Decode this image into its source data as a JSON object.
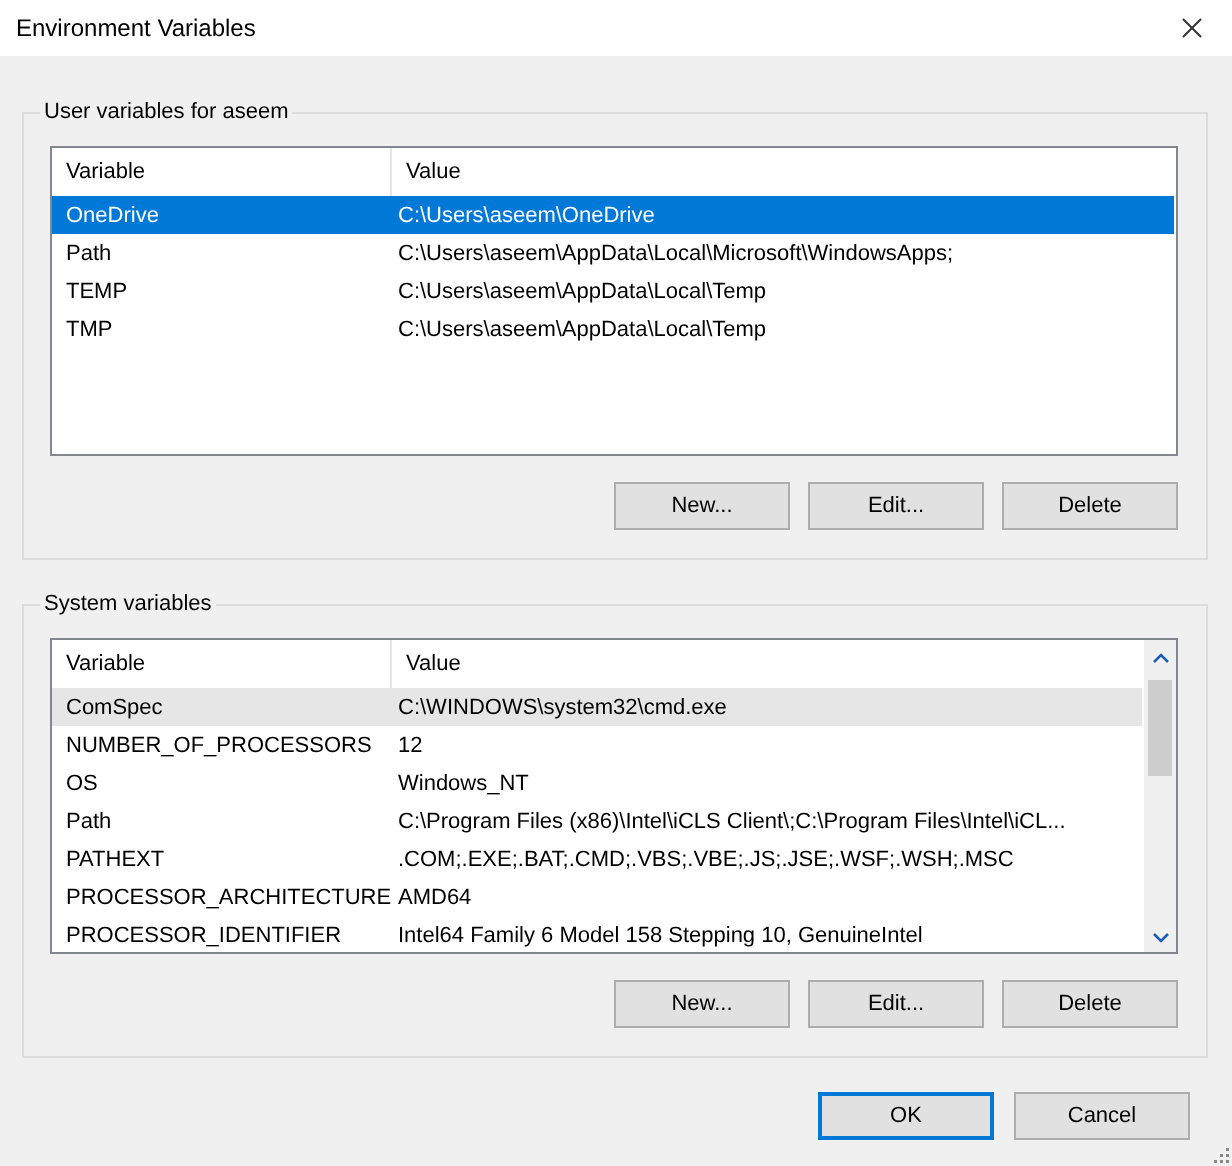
{
  "window": {
    "title": "Environment Variables"
  },
  "user_variables": {
    "label": "User variables for aseem",
    "columns": [
      "Variable",
      "Value"
    ],
    "focused": true,
    "rows": [
      {
        "variable": "OneDrive",
        "value": "C:\\Users\\aseem\\OneDrive",
        "selected": true
      },
      {
        "variable": "Path",
        "value": "C:\\Users\\aseem\\AppData\\Local\\Microsoft\\WindowsApps;",
        "selected": false
      },
      {
        "variable": "TEMP",
        "value": "C:\\Users\\aseem\\AppData\\Local\\Temp",
        "selected": false
      },
      {
        "variable": "TMP",
        "value": "C:\\Users\\aseem\\AppData\\Local\\Temp",
        "selected": false
      }
    ],
    "buttons": [
      "New...",
      "Edit...",
      "Delete"
    ]
  },
  "system_variables": {
    "label": "System variables",
    "columns": [
      "Variable",
      "Value"
    ],
    "focused": false,
    "rows": [
      {
        "variable": "ComSpec",
        "value": "C:\\WINDOWS\\system32\\cmd.exe",
        "selected": true
      },
      {
        "variable": "NUMBER_OF_PROCESSORS",
        "value": "12",
        "selected": false
      },
      {
        "variable": "OS",
        "value": "Windows_NT",
        "selected": false
      },
      {
        "variable": "Path",
        "value": "C:\\Program Files (x86)\\Intel\\iCLS Client\\;C:\\Program Files\\Intel\\iCL...",
        "selected": false
      },
      {
        "variable": "PATHEXT",
        "value": ".COM;.EXE;.BAT;.CMD;.VBS;.VBE;.JS;.JSE;.WSF;.WSH;.MSC",
        "selected": false
      },
      {
        "variable": "PROCESSOR_ARCHITECTURE",
        "value": "AMD64",
        "selected": false
      },
      {
        "variable": "PROCESSOR_IDENTIFIER",
        "value": "Intel64 Family 6 Model 158 Stepping 10, GenuineIntel",
        "selected": false
      }
    ],
    "buttons": [
      "New...",
      "Edit...",
      "Delete"
    ]
  },
  "buttons": [
    {
      "label": "OK",
      "default": true
    },
    {
      "label": "Cancel",
      "default": false
    }
  ]
}
